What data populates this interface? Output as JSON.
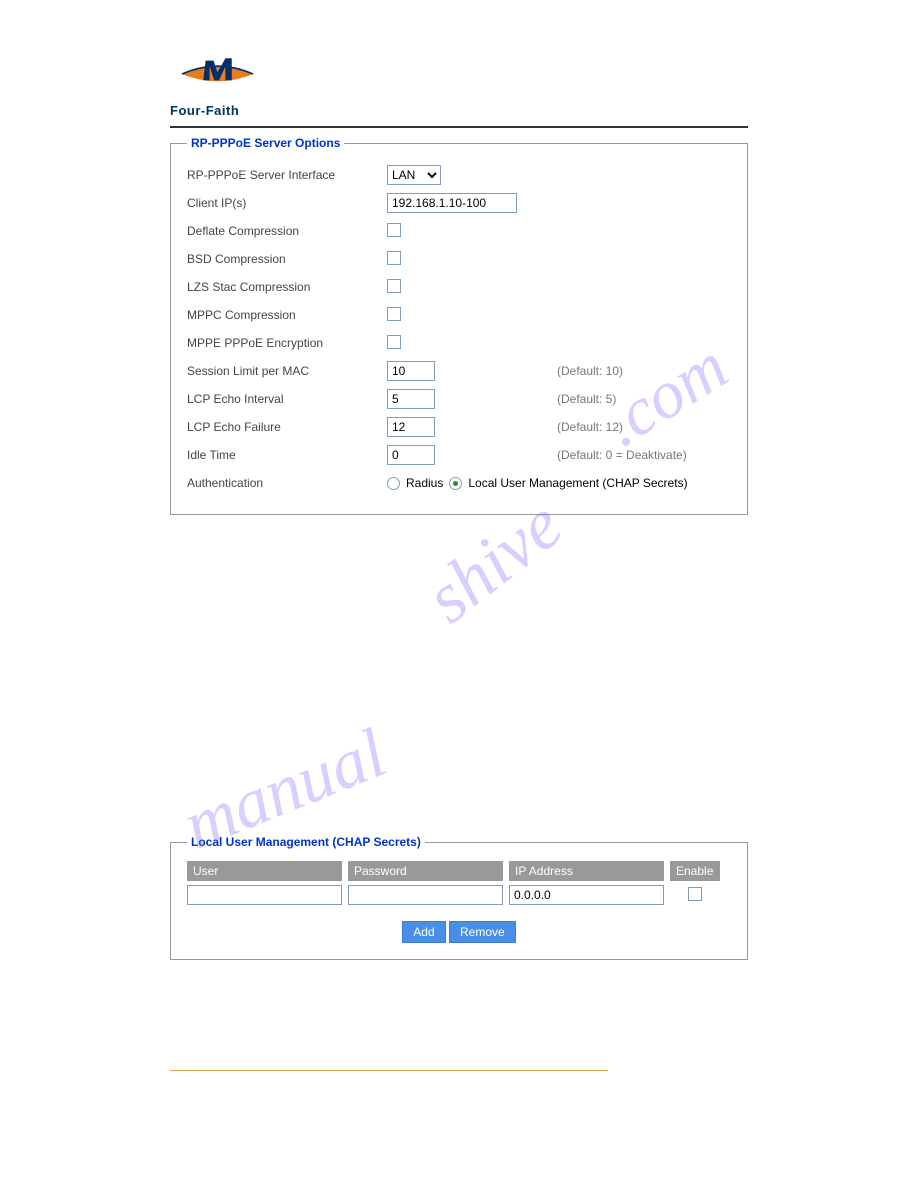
{
  "logo": {
    "text": "Four-Faith"
  },
  "section1": {
    "legend": "RP-PPPoE Server Options",
    "interface": {
      "label": "RP-PPPoE Server Interface",
      "value": "LAN"
    },
    "clientip": {
      "label": "Client IP(s)",
      "value": "192.168.1.10-100"
    },
    "deflate": {
      "label": "Deflate Compression"
    },
    "bsd": {
      "label": "BSD Compression"
    },
    "lzs": {
      "label": "LZS Stac Compression"
    },
    "mppc": {
      "label": "MPPC Compression"
    },
    "mppe": {
      "label": "MPPE PPPoE Encryption"
    },
    "session": {
      "label": "Session Limit per MAC",
      "value": "10",
      "hint": "(Default: 10)"
    },
    "echo_interval": {
      "label": "LCP Echo Interval",
      "value": "5",
      "hint": "(Default: 5)"
    },
    "echo_failure": {
      "label": "LCP Echo Failure",
      "value": "12",
      "hint": "(Default: 12)"
    },
    "idle": {
      "label": "Idle Time",
      "value": "0",
      "hint": "(Default: 0 = Deaktivate)"
    },
    "auth": {
      "label": "Authentication",
      "radius": "Radius",
      "local": "Local User Management (CHAP Secrets)"
    }
  },
  "section2": {
    "legend": "Local User Management (CHAP Secrets)",
    "headers": {
      "user": "User",
      "password": "Password",
      "ip": "IP Address",
      "enable": "Enable"
    },
    "row": {
      "user": "",
      "password": "",
      "ip": "0.0.0.0"
    },
    "buttons": {
      "add": "Add",
      "remove": "Remove"
    }
  },
  "watermark": {
    "p1": ".com",
    "p2": "shive",
    "p3": "manual"
  }
}
